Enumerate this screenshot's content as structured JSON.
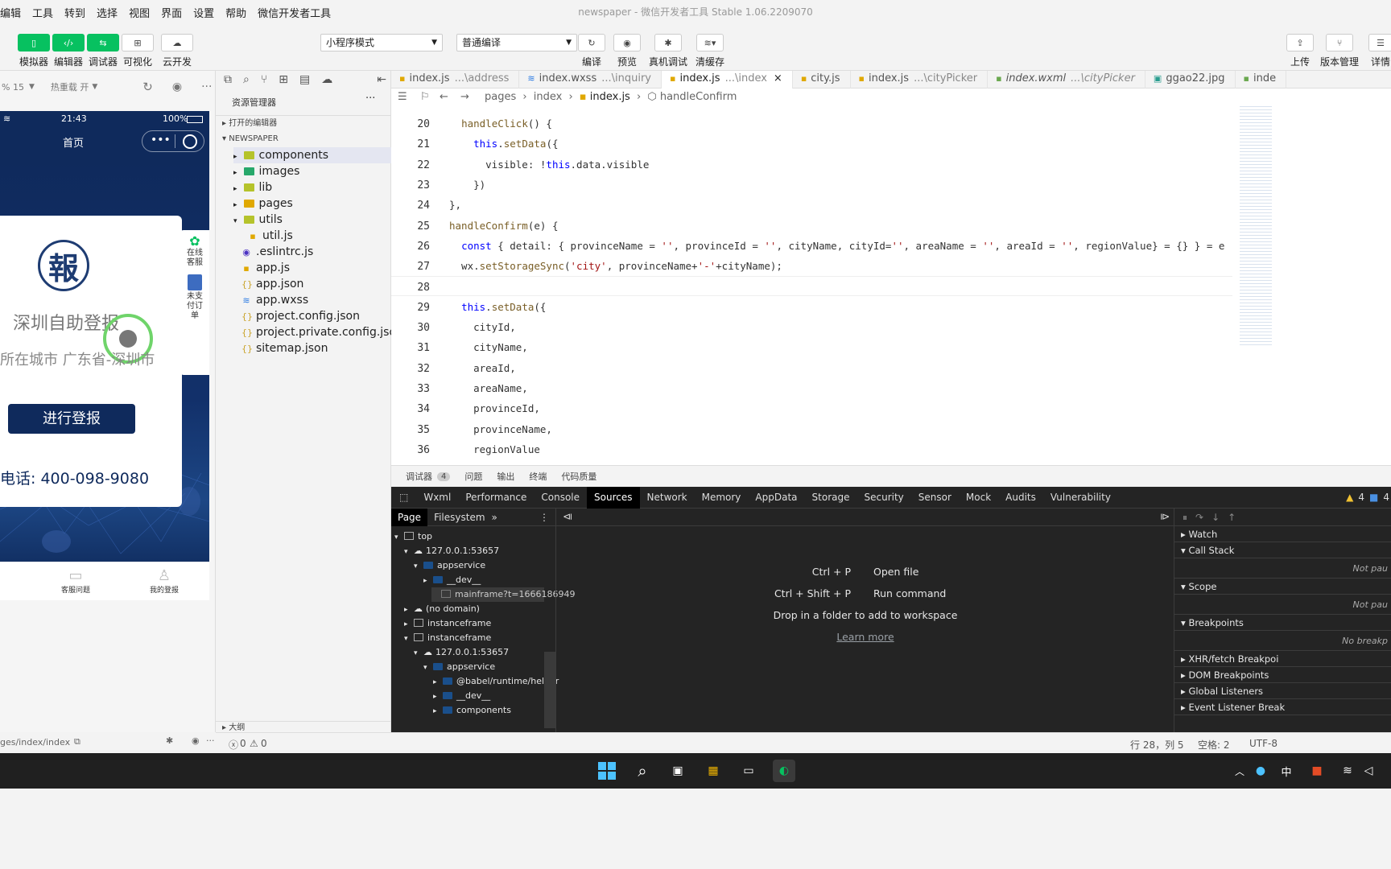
{
  "menubar": {
    "items": [
      "编辑",
      "工具",
      "转到",
      "选择",
      "视图",
      "界面",
      "设置",
      "帮助",
      "微信开发者工具"
    ],
    "window_title": "newspaper - 微信开发者工具 Stable 1.06.2209070"
  },
  "toolbar": {
    "left": [
      {
        "label": "模拟器",
        "icon": "phone-icon"
      },
      {
        "label": "编辑器",
        "icon": "code-icon"
      },
      {
        "label": "调试器",
        "icon": "debugger-icon"
      },
      {
        "label": "可视化",
        "icon": "layout-icon"
      },
      {
        "label": "云开发",
        "icon": "cloud-icon"
      }
    ],
    "mode_select": "小程序模式",
    "compile_select": "普通编译",
    "center": [
      {
        "label": "编译",
        "icon": "refresh-icon"
      },
      {
        "label": "预览",
        "icon": "eye-icon"
      },
      {
        "label": "真机调试",
        "icon": "bug-icon"
      },
      {
        "label": "清缓存",
        "icon": "layers-icon"
      }
    ],
    "right": [
      {
        "label": "上传",
        "icon": "upload-icon"
      },
      {
        "label": "版本管理",
        "icon": "branch-icon"
      },
      {
        "label": "详情",
        "icon": "menu-icon"
      }
    ]
  },
  "simulator": {
    "zoom": "% 15",
    "hotreload": "热重载 开",
    "status_time": "21:43",
    "battery": "100%",
    "nav_title": "首页",
    "seal_char": "報",
    "app_title": "深圳自助登报",
    "city_line": "所在城市  广东省-深圳市",
    "cta": "进行登报",
    "phone": "电话: 400-098-9080",
    "side_service": "在线客服",
    "side_unpaid": "未支付订单",
    "tabbar": [
      "客服问题",
      "我的登报"
    ],
    "page_path": "ges/index/index"
  },
  "explorer": {
    "title": "资源管理器",
    "open_editors": "打开的编辑器",
    "project": "NEWSPAPER",
    "items": [
      {
        "name": "components",
        "type": "folder",
        "color": "#b5c32b"
      },
      {
        "name": "images",
        "type": "folder",
        "color": "#27a86b"
      },
      {
        "name": "lib",
        "type": "folder",
        "color": "#b5c32b"
      },
      {
        "name": "pages",
        "type": "folder",
        "color": "#e0a800"
      },
      {
        "name": "utils",
        "type": "folder",
        "color": "#b5c32b"
      },
      {
        "name": "util.js",
        "type": "js"
      },
      {
        "name": ".eslintrc.js",
        "type": "eslint"
      },
      {
        "name": "app.js",
        "type": "js"
      },
      {
        "name": "app.json",
        "type": "json"
      },
      {
        "name": "app.wxss",
        "type": "css"
      },
      {
        "name": "project.config.json",
        "type": "json"
      },
      {
        "name": "project.private.config.json",
        "type": "json"
      },
      {
        "name": "sitemap.json",
        "type": "json"
      }
    ],
    "outline": "大纲"
  },
  "tabs": [
    {
      "name": "index.js",
      "path": "...\\address"
    },
    {
      "name": "index.wxss",
      "path": "...\\inquiry"
    },
    {
      "name": "index.js",
      "path": "...\\index",
      "active": true
    },
    {
      "name": "city.js",
      "path": ""
    },
    {
      "name": "index.js",
      "path": "...\\cityPicker"
    },
    {
      "name": "index.wxml",
      "path": "...\\cityPicker"
    },
    {
      "name": "ggao22.jpg",
      "path": ""
    },
    {
      "name": "inde",
      "path": ""
    }
  ],
  "breadcrumb": [
    "pages",
    "index",
    "index.js",
    "handleConfirm"
  ],
  "code": [
    {
      "n": "20",
      "t": "  handleClick() {"
    },
    {
      "n": "21",
      "t": "    this.setData({"
    },
    {
      "n": "22",
      "t": "      visible: !this.data.visible"
    },
    {
      "n": "23",
      "t": "    })"
    },
    {
      "n": "24",
      "t": "},"
    },
    {
      "n": "25",
      "t": "handleConfirm(e) {"
    },
    {
      "n": "26",
      "t": "  const { detail: { provinceName = '', provinceId = '', cityName, cityId='', areaName = '', areaId = '', regionValue} = {} } = e"
    },
    {
      "n": "27",
      "t": "  wx.setStorageSync('city', provinceName+'-'+cityName);"
    },
    {
      "n": "28",
      "t": ""
    },
    {
      "n": "29",
      "t": "  this.setData({"
    },
    {
      "n": "30",
      "t": "    cityId,"
    },
    {
      "n": "31",
      "t": "    cityName,"
    },
    {
      "n": "32",
      "t": "    areaId,"
    },
    {
      "n": "33",
      "t": "    areaName,"
    },
    {
      "n": "34",
      "t": "    provinceId,"
    },
    {
      "n": "35",
      "t": "    provinceName,"
    },
    {
      "n": "36",
      "t": "    regionValue"
    }
  ],
  "panel_tabs": {
    "debugger": "调试器",
    "debugger_count": "4",
    "items": [
      "问题",
      "输出",
      "终端",
      "代码质量"
    ]
  },
  "devtools": {
    "tabs": [
      "Wxml",
      "Performance",
      "Console",
      "Sources",
      "Network",
      "Memory",
      "AppData",
      "Storage",
      "Security",
      "Sensor",
      "Mock",
      "Audits",
      "Vulnerability"
    ],
    "active": "Sources",
    "warn_count": "4",
    "msg_count": "4",
    "nav_tabs": [
      "Page",
      "Filesystem"
    ],
    "tree": [
      "top",
      "127.0.0.1:53657",
      "appservice",
      "__dev__",
      "mainframe?t=1666186949",
      "(no domain)",
      "instanceframe",
      "instanceframe",
      "127.0.0.1:53657",
      "appservice",
      "@babel/runtime/helper",
      "__dev__",
      "components"
    ],
    "shortcuts": [
      {
        "keys": "Ctrl + P",
        "action": "Open file"
      },
      {
        "keys": "Ctrl + Shift + P",
        "action": "Run command"
      }
    ],
    "drop_hint": "Drop in a folder to add to workspace",
    "learn_more": "Learn more",
    "right": {
      "watch": "Watch",
      "call_stack": "Call Stack",
      "not_paused": "Not pau",
      "scope": "Scope",
      "not_paused2": "Not pau",
      "breakpoints": "Breakpoints",
      "no_breakpoints": "No breakp",
      "xhr": "XHR/fetch Breakpoi",
      "dom": "DOM Breakpoints",
      "global": "Global Listeners",
      "event": "Event Listener Break"
    }
  },
  "statusbar": {
    "errors": "0",
    "warnings": "0",
    "position": "行 28，列 5",
    "spaces": "空格: 2",
    "encoding": "UTF-8"
  },
  "taskbar": {
    "ime": "中"
  }
}
